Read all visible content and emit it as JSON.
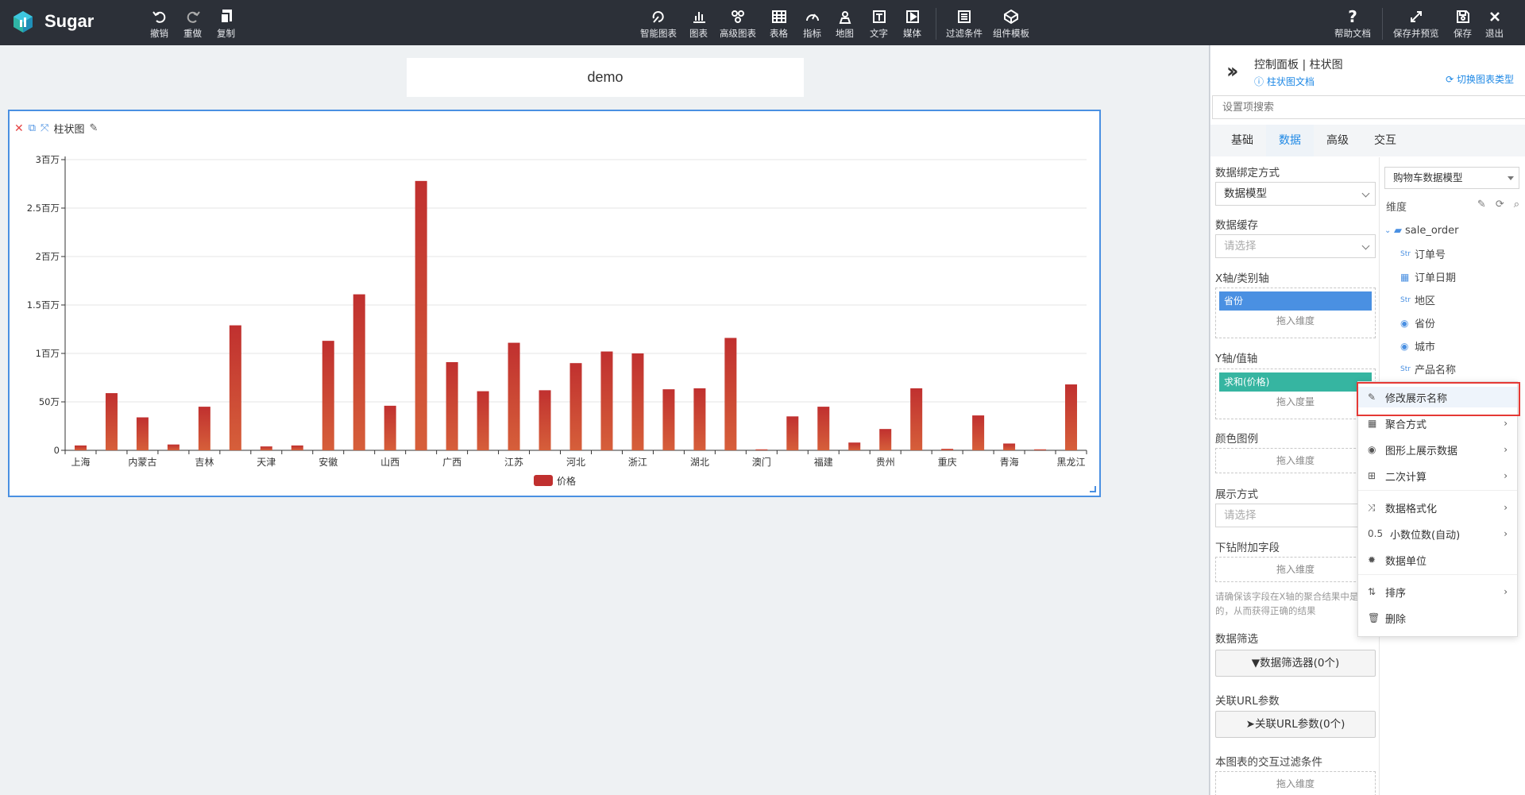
{
  "app": {
    "name": "Sugar"
  },
  "toolbar": {
    "left": [
      {
        "label": "撤销",
        "icon": "undo-icon"
      },
      {
        "label": "重做",
        "icon": "redo-icon"
      },
      {
        "label": "复制",
        "icon": "copy-icon"
      }
    ],
    "center": [
      {
        "label": "智能图表",
        "icon": "smart-chart-icon"
      },
      {
        "label": "图表",
        "icon": "bar-chart-icon"
      },
      {
        "label": "高级图表",
        "icon": "advanced-chart-icon"
      },
      {
        "label": "表格",
        "icon": "table-icon"
      },
      {
        "label": "指标",
        "icon": "gauge-icon"
      },
      {
        "label": "地图",
        "icon": "map-pin-icon"
      },
      {
        "label": "文字",
        "icon": "text-icon"
      },
      {
        "label": "媒体",
        "icon": "media-icon"
      },
      {
        "label": "过滤条件",
        "icon": "filter-list-icon"
      },
      {
        "label": "组件模板",
        "icon": "template-icon"
      }
    ],
    "right": [
      {
        "label": "帮助文档",
        "icon": "help-icon"
      },
      {
        "label": "保存并预览",
        "icon": "expand-icon"
      },
      {
        "label": "保存",
        "icon": "save-icon"
      },
      {
        "label": "退出",
        "icon": "close-icon"
      }
    ]
  },
  "canvas": {
    "title": "demo",
    "card_title": "柱状图"
  },
  "chart_data": {
    "type": "bar",
    "categories": [
      "上海",
      "",
      "内蒙古",
      "",
      "吉林",
      "",
      "天津",
      "",
      "安徽",
      "",
      "山西",
      "",
      "广西",
      "",
      "江苏",
      "",
      "河北",
      "",
      "浙江",
      "",
      "湖北",
      "",
      "澳门",
      "",
      "福建",
      "",
      "贵州",
      "",
      "重庆",
      "",
      "青海",
      "",
      "黑龙江"
    ],
    "series": [
      {
        "name": "价格",
        "values": [
          50000,
          590000,
          340000,
          60000,
          450000,
          1290000,
          40000,
          50000,
          1130000,
          1610000,
          460000,
          2780000,
          910000,
          610000,
          1110000,
          620000,
          900000,
          1020000,
          1000000,
          630000,
          640000,
          1160000,
          10000,
          350000,
          450000,
          80000,
          220000,
          640000,
          15000,
          360000,
          70000,
          10000,
          680000
        ]
      }
    ],
    "ylim": [
      0,
      3000000
    ],
    "yticks": [
      "0",
      "50万",
      "1百万",
      "1.5百万",
      "2百万",
      "2.5百万",
      "3百万"
    ],
    "legend": "bottom-center",
    "grid": true,
    "colors": {
      "top": "#c0302f",
      "bottom": "#d65f3a"
    }
  },
  "panel": {
    "title": "控制面板 | 柱状图",
    "doc_link": "柱状图文档",
    "switch_link": "切换图表类型",
    "search_placeholder": "设置项搜索",
    "tabs": [
      "基础",
      "数据",
      "高级",
      "交互"
    ],
    "active_tab": "数据",
    "fields": {
      "binding_label": "数据绑定方式",
      "binding_value": "数据模型",
      "cache_label": "数据缓存",
      "cache_placeholder": "请选择",
      "xaxis_label": "X轴/类别轴",
      "xaxis_pill": "省份",
      "drop_dim": "拖入维度",
      "yaxis_label": "Y轴/值轴",
      "yaxis_pill": "求和(价格)",
      "drop_measure": "拖入度量",
      "color_label": "颜色图例",
      "display_label": "展示方式",
      "display_placeholder": "请选择",
      "drill_label": "下钻附加字段",
      "note": "请确保该字段在X轴的聚合结果中是相同的，从而获得正确的结果",
      "filter_label": "数据筛选",
      "filter_btn": "数据筛选器(0个)",
      "url_label": "关联URL参数",
      "url_btn": "关联URL参数(0个)",
      "interact_label": "本图表的交互过滤条件"
    },
    "model": {
      "selected": "购物车数据模型",
      "dim_label": "维度",
      "tree_root": "sale_order",
      "tree_items": [
        {
          "prefix": "Str",
          "label": "订单号"
        },
        {
          "prefix": "date",
          "label": "订单日期"
        },
        {
          "prefix": "Str",
          "label": "地区"
        },
        {
          "prefix": "geo",
          "label": "省份"
        },
        {
          "prefix": "geo",
          "label": "城市"
        },
        {
          "prefix": "Str",
          "label": "产品名称"
        }
      ]
    },
    "context_menu": [
      {
        "label": "修改展示名称",
        "icon": "edit-icon",
        "has_sub": false
      },
      {
        "label": "聚合方式",
        "icon": "calculator-icon",
        "has_sub": true
      },
      {
        "label": "图形上展示数据",
        "icon": "eye-icon",
        "has_sub": true
      },
      {
        "label": "二次计算",
        "icon": "plus-square-icon",
        "has_sub": true
      },
      {
        "label": "数据格式化",
        "icon": "shuffle-icon",
        "has_sub": true
      },
      {
        "label": "小数位数(自动)",
        "icon": "decimal-icon",
        "icon_text": "0.5",
        "has_sub": true
      },
      {
        "label": "数据单位",
        "icon": "gear-icon",
        "has_sub": false
      },
      {
        "label": "排序",
        "icon": "sort-icon",
        "has_sub": true
      },
      {
        "label": "删除",
        "icon": "trash-icon",
        "has_sub": false
      }
    ]
  }
}
